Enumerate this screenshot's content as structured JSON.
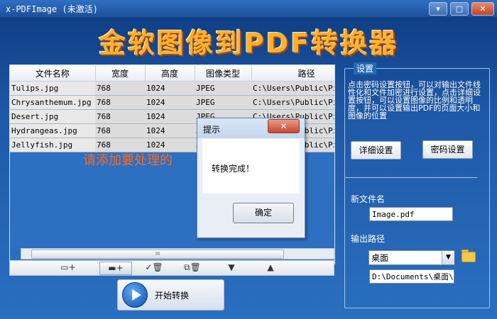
{
  "window": {
    "title": "x-PDFImage (未激活)",
    "controls": {
      "minimize": "▾",
      "maximize": "□",
      "close": "✕"
    }
  },
  "banner": {
    "text": "金软图像到PDF转换器"
  },
  "file_table": {
    "columns": [
      "文件名称",
      "宽度",
      "高度",
      "图像类型",
      "路径"
    ],
    "rows": [
      {
        "name": "Tulips.jpg",
        "width": "768",
        "height": "1024",
        "type": "JPEG",
        "path": "C:\\Users\\Public\\Pic"
      },
      {
        "name": "Chrysanthemum.jpg",
        "width": "768",
        "height": "1024",
        "type": "JPEG",
        "path": "C:\\Users\\Public\\Pic"
      },
      {
        "name": "Desert.jpg",
        "width": "768",
        "height": "1024",
        "type": "JPEG",
        "path": "C:\\Users\\Public\\Pic"
      },
      {
        "name": "Hydrangeas.jpg",
        "width": "768",
        "height": "1024",
        "type": "JPEG",
        "path": "C:\\Users\\Public\\Pic"
      },
      {
        "name": "Jellyfish.jpg",
        "width": "768",
        "height": "1024",
        "type": "JPEG",
        "path": "C:\\Users\\Public\\Pic"
      }
    ],
    "hint": "请添加要处理的",
    "scroll_thumb": "III"
  },
  "toolbar": {
    "add_file": "▭+",
    "add_folder": "▬+",
    "remove_checked": "✓🗑",
    "remove_all": "⧉🗑",
    "move_down": "▼",
    "move_up": "▲"
  },
  "start": {
    "label": "开始转换"
  },
  "settings": {
    "title": "设置",
    "description": "点击密码设置按钮，可以对输出文件线性化和文件加密进行设置，点击详细设置按钮，可以设置图像的比例和透明度，并可以设置输出PDF的页面大小和图像的位置",
    "detail_button": "详细设置",
    "password_button": "密码设置",
    "new_file_label": "新文件名",
    "new_file_value": "Image.pdf",
    "output_path_label": "输出路径",
    "output_path_selected": "桌面",
    "output_path_value": "D:\\Documents\\桌面\\"
  },
  "dialog": {
    "title": "提示",
    "close": "✕",
    "message": "转换完成！",
    "ok": "确定"
  }
}
